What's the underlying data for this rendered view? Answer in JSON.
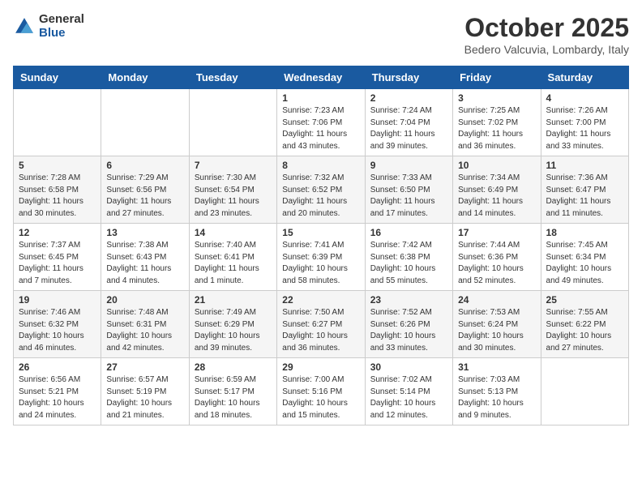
{
  "logo": {
    "general": "General",
    "blue": "Blue"
  },
  "title": "October 2025",
  "location": "Bedero Valcuvia, Lombardy, Italy",
  "weekdays": [
    "Sunday",
    "Monday",
    "Tuesday",
    "Wednesday",
    "Thursday",
    "Friday",
    "Saturday"
  ],
  "weeks": [
    [
      {
        "day": "",
        "sunrise": "",
        "sunset": "",
        "daylight": ""
      },
      {
        "day": "",
        "sunrise": "",
        "sunset": "",
        "daylight": ""
      },
      {
        "day": "",
        "sunrise": "",
        "sunset": "",
        "daylight": ""
      },
      {
        "day": "1",
        "sunrise": "Sunrise: 7:23 AM",
        "sunset": "Sunset: 7:06 PM",
        "daylight": "Daylight: 11 hours and 43 minutes."
      },
      {
        "day": "2",
        "sunrise": "Sunrise: 7:24 AM",
        "sunset": "Sunset: 7:04 PM",
        "daylight": "Daylight: 11 hours and 39 minutes."
      },
      {
        "day": "3",
        "sunrise": "Sunrise: 7:25 AM",
        "sunset": "Sunset: 7:02 PM",
        "daylight": "Daylight: 11 hours and 36 minutes."
      },
      {
        "day": "4",
        "sunrise": "Sunrise: 7:26 AM",
        "sunset": "Sunset: 7:00 PM",
        "daylight": "Daylight: 11 hours and 33 minutes."
      }
    ],
    [
      {
        "day": "5",
        "sunrise": "Sunrise: 7:28 AM",
        "sunset": "Sunset: 6:58 PM",
        "daylight": "Daylight: 11 hours and 30 minutes."
      },
      {
        "day": "6",
        "sunrise": "Sunrise: 7:29 AM",
        "sunset": "Sunset: 6:56 PM",
        "daylight": "Daylight: 11 hours and 27 minutes."
      },
      {
        "day": "7",
        "sunrise": "Sunrise: 7:30 AM",
        "sunset": "Sunset: 6:54 PM",
        "daylight": "Daylight: 11 hours and 23 minutes."
      },
      {
        "day": "8",
        "sunrise": "Sunrise: 7:32 AM",
        "sunset": "Sunset: 6:52 PM",
        "daylight": "Daylight: 11 hours and 20 minutes."
      },
      {
        "day": "9",
        "sunrise": "Sunrise: 7:33 AM",
        "sunset": "Sunset: 6:50 PM",
        "daylight": "Daylight: 11 hours and 17 minutes."
      },
      {
        "day": "10",
        "sunrise": "Sunrise: 7:34 AM",
        "sunset": "Sunset: 6:49 PM",
        "daylight": "Daylight: 11 hours and 14 minutes."
      },
      {
        "day": "11",
        "sunrise": "Sunrise: 7:36 AM",
        "sunset": "Sunset: 6:47 PM",
        "daylight": "Daylight: 11 hours and 11 minutes."
      }
    ],
    [
      {
        "day": "12",
        "sunrise": "Sunrise: 7:37 AM",
        "sunset": "Sunset: 6:45 PM",
        "daylight": "Daylight: 11 hours and 7 minutes."
      },
      {
        "day": "13",
        "sunrise": "Sunrise: 7:38 AM",
        "sunset": "Sunset: 6:43 PM",
        "daylight": "Daylight: 11 hours and 4 minutes."
      },
      {
        "day": "14",
        "sunrise": "Sunrise: 7:40 AM",
        "sunset": "Sunset: 6:41 PM",
        "daylight": "Daylight: 11 hours and 1 minute."
      },
      {
        "day": "15",
        "sunrise": "Sunrise: 7:41 AM",
        "sunset": "Sunset: 6:39 PM",
        "daylight": "Daylight: 10 hours and 58 minutes."
      },
      {
        "day": "16",
        "sunrise": "Sunrise: 7:42 AM",
        "sunset": "Sunset: 6:38 PM",
        "daylight": "Daylight: 10 hours and 55 minutes."
      },
      {
        "day": "17",
        "sunrise": "Sunrise: 7:44 AM",
        "sunset": "Sunset: 6:36 PM",
        "daylight": "Daylight: 10 hours and 52 minutes."
      },
      {
        "day": "18",
        "sunrise": "Sunrise: 7:45 AM",
        "sunset": "Sunset: 6:34 PM",
        "daylight": "Daylight: 10 hours and 49 minutes."
      }
    ],
    [
      {
        "day": "19",
        "sunrise": "Sunrise: 7:46 AM",
        "sunset": "Sunset: 6:32 PM",
        "daylight": "Daylight: 10 hours and 46 minutes."
      },
      {
        "day": "20",
        "sunrise": "Sunrise: 7:48 AM",
        "sunset": "Sunset: 6:31 PM",
        "daylight": "Daylight: 10 hours and 42 minutes."
      },
      {
        "day": "21",
        "sunrise": "Sunrise: 7:49 AM",
        "sunset": "Sunset: 6:29 PM",
        "daylight": "Daylight: 10 hours and 39 minutes."
      },
      {
        "day": "22",
        "sunrise": "Sunrise: 7:50 AM",
        "sunset": "Sunset: 6:27 PM",
        "daylight": "Daylight: 10 hours and 36 minutes."
      },
      {
        "day": "23",
        "sunrise": "Sunrise: 7:52 AM",
        "sunset": "Sunset: 6:26 PM",
        "daylight": "Daylight: 10 hours and 33 minutes."
      },
      {
        "day": "24",
        "sunrise": "Sunrise: 7:53 AM",
        "sunset": "Sunset: 6:24 PM",
        "daylight": "Daylight: 10 hours and 30 minutes."
      },
      {
        "day": "25",
        "sunrise": "Sunrise: 7:55 AM",
        "sunset": "Sunset: 6:22 PM",
        "daylight": "Daylight: 10 hours and 27 minutes."
      }
    ],
    [
      {
        "day": "26",
        "sunrise": "Sunrise: 6:56 AM",
        "sunset": "Sunset: 5:21 PM",
        "daylight": "Daylight: 10 hours and 24 minutes."
      },
      {
        "day": "27",
        "sunrise": "Sunrise: 6:57 AM",
        "sunset": "Sunset: 5:19 PM",
        "daylight": "Daylight: 10 hours and 21 minutes."
      },
      {
        "day": "28",
        "sunrise": "Sunrise: 6:59 AM",
        "sunset": "Sunset: 5:17 PM",
        "daylight": "Daylight: 10 hours and 18 minutes."
      },
      {
        "day": "29",
        "sunrise": "Sunrise: 7:00 AM",
        "sunset": "Sunset: 5:16 PM",
        "daylight": "Daylight: 10 hours and 15 minutes."
      },
      {
        "day": "30",
        "sunrise": "Sunrise: 7:02 AM",
        "sunset": "Sunset: 5:14 PM",
        "daylight": "Daylight: 10 hours and 12 minutes."
      },
      {
        "day": "31",
        "sunrise": "Sunrise: 7:03 AM",
        "sunset": "Sunset: 5:13 PM",
        "daylight": "Daylight: 10 hours and 9 minutes."
      },
      {
        "day": "",
        "sunrise": "",
        "sunset": "",
        "daylight": ""
      }
    ]
  ]
}
